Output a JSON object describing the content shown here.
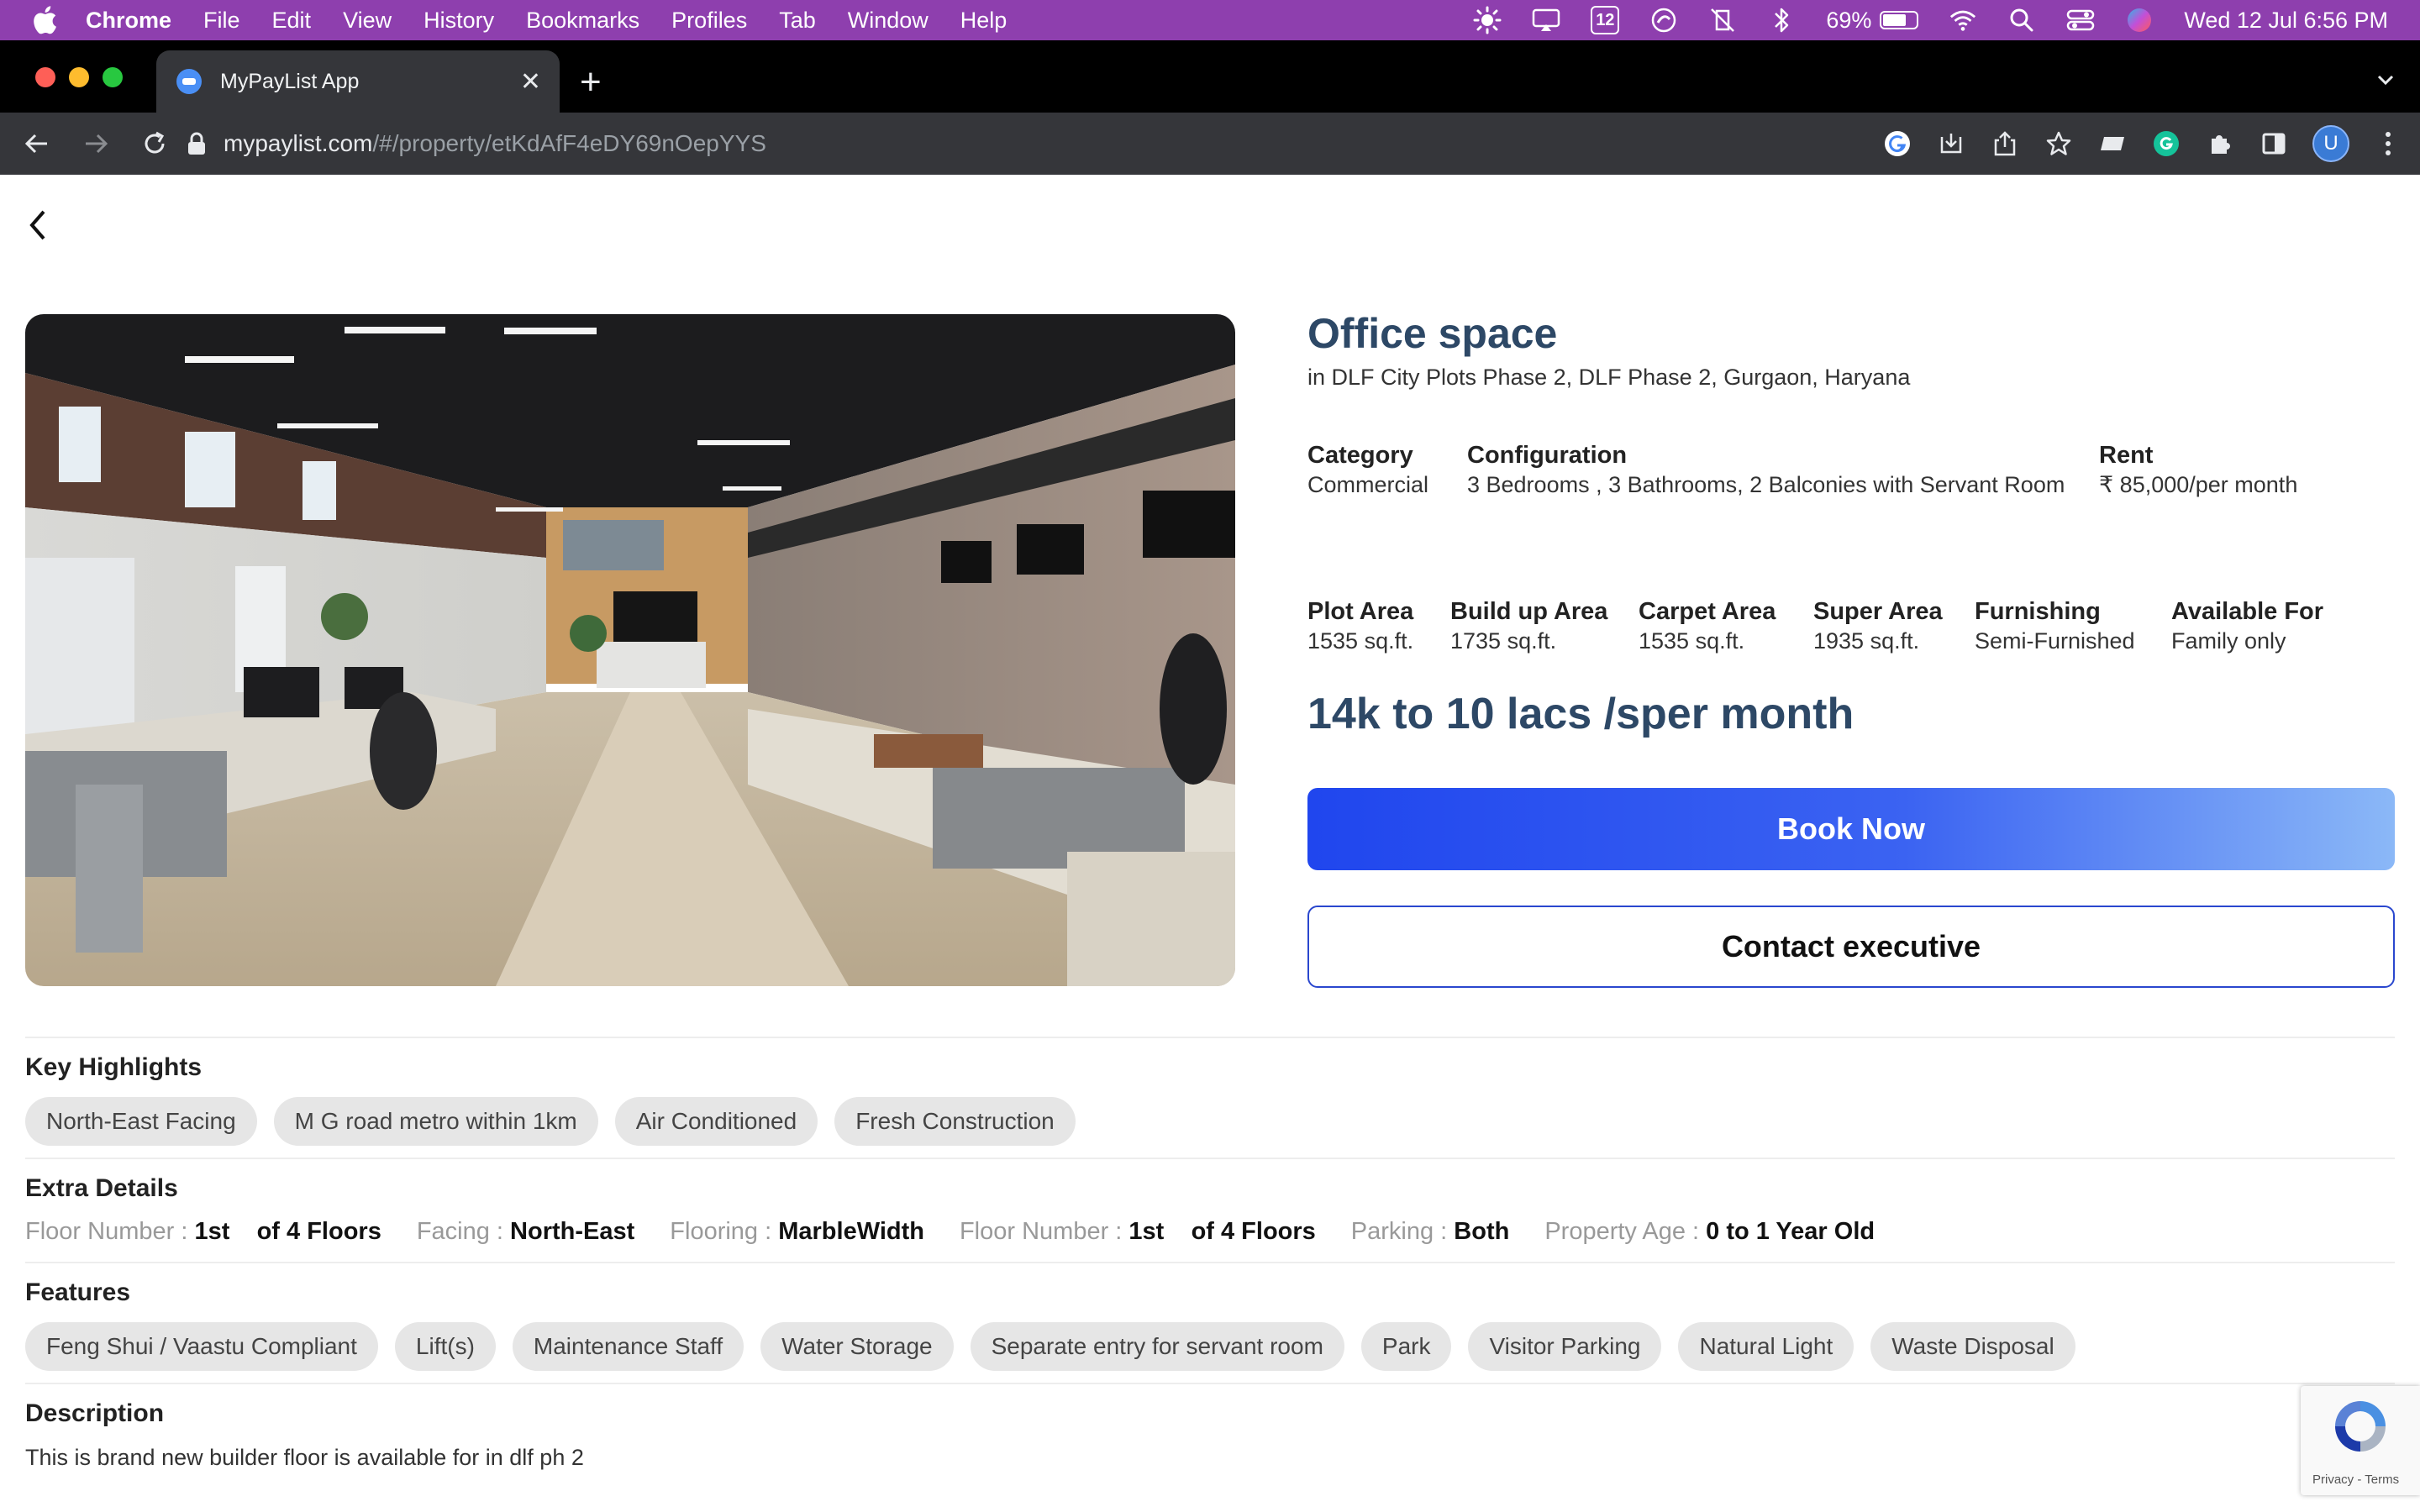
{
  "menubar": {
    "app": "Chrome",
    "items": [
      "File",
      "Edit",
      "View",
      "History",
      "Bookmarks",
      "Profiles",
      "Tab",
      "Window",
      "Help"
    ],
    "badge": "12",
    "battery_percent": "69%",
    "battery_level": 0.69,
    "datetime": "Wed 12 Jul  6:56 PM"
  },
  "browser": {
    "tab_title": "MyPayList App",
    "url_host": "mypaylist.com",
    "url_path": "/#/property/etKdAfF4eDY69nOepYYS",
    "avatar_letter": "U"
  },
  "property": {
    "title": "Office space",
    "location": "in  DLF City Plots Phase 2, DLF Phase 2, Gurgaon, Haryana",
    "specs_row1": [
      {
        "label": "Category",
        "value": "Commercial"
      },
      {
        "label": "Configuration",
        "value": "3 Bedrooms , 3 Bathrooms, 2 Balconies with Servant Room"
      },
      {
        "label": "Rent",
        "value": "₹  85,000/per month"
      }
    ],
    "specs_row2": [
      {
        "label": "Plot Area",
        "value": "1535 sq.ft."
      },
      {
        "label": "Build up Area",
        "value": "1735 sq.ft."
      },
      {
        "label": "Carpet Area",
        "value": "1535 sq.ft."
      },
      {
        "label": "Super Area",
        "value": "1935 sq.ft."
      },
      {
        "label": "Furnishing",
        "value": "Semi-Furnished"
      },
      {
        "label": "Available For",
        "value": "Family only"
      }
    ],
    "price_range": "14k to 10 lacs /sper month",
    "book_label": "Book Now",
    "contact_label": "Contact executive"
  },
  "highlights": {
    "heading": "Key Highlights",
    "items": [
      "North-East Facing",
      "M G road metro within 1km",
      "Air Conditioned",
      "Fresh Construction"
    ]
  },
  "extra": {
    "heading": "Extra Details",
    "items": [
      {
        "label": "Floor Number : ",
        "value": "1st    of 4 Floors"
      },
      {
        "label": "Facing : ",
        "value": "North-East"
      },
      {
        "label": "Flooring : ",
        "value": "MarbleWidth"
      },
      {
        "label": "Floor Number : ",
        "value": "1st    of 4 Floors"
      },
      {
        "label": "Parking : ",
        "value": "Both"
      },
      {
        "label": "Property Age : ",
        "value": "0 to 1 Year Old"
      }
    ]
  },
  "features": {
    "heading": "Features",
    "items": [
      "Feng Shui / Vaastu Compliant",
      "Lift(s)",
      "Maintenance Staff",
      "Water Storage",
      "Separate entry for servant room",
      "Park",
      "Visitor Parking",
      "Natural Light",
      "Waste Disposal"
    ]
  },
  "description": {
    "heading": "Description",
    "text": "This is brand new builder floor is available for in dlf ph 2"
  },
  "recaptcha": {
    "links": "Privacy - Terms"
  }
}
